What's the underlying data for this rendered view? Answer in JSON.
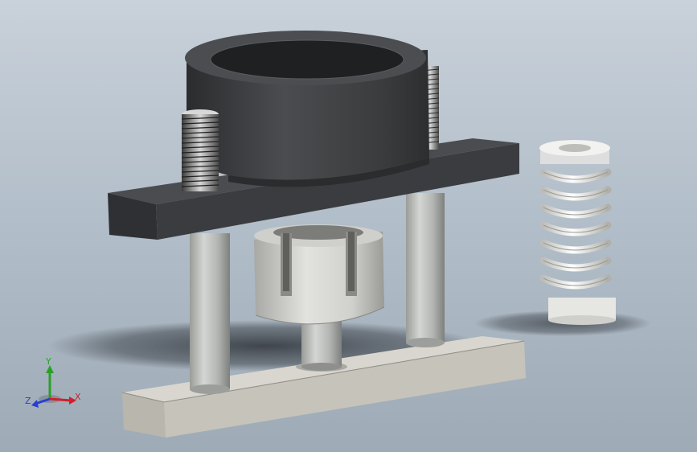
{
  "triad": {
    "x_label": "X",
    "y_label": "Y",
    "z_label": "Z"
  },
  "colors": {
    "background_top": "#c9d1da",
    "background_bottom": "#9eabb7",
    "die_set_plate": "#3a3c3f",
    "ring_part": "#3c3e41",
    "base_plate": "#c8c5bd",
    "guide_pillar": "#b6b8b5",
    "collet": "#d5d5d2",
    "spring": "#f0f0ee",
    "axis_x": "#d0202a",
    "axis_y": "#2aa02a",
    "axis_z": "#2a3fd0"
  }
}
